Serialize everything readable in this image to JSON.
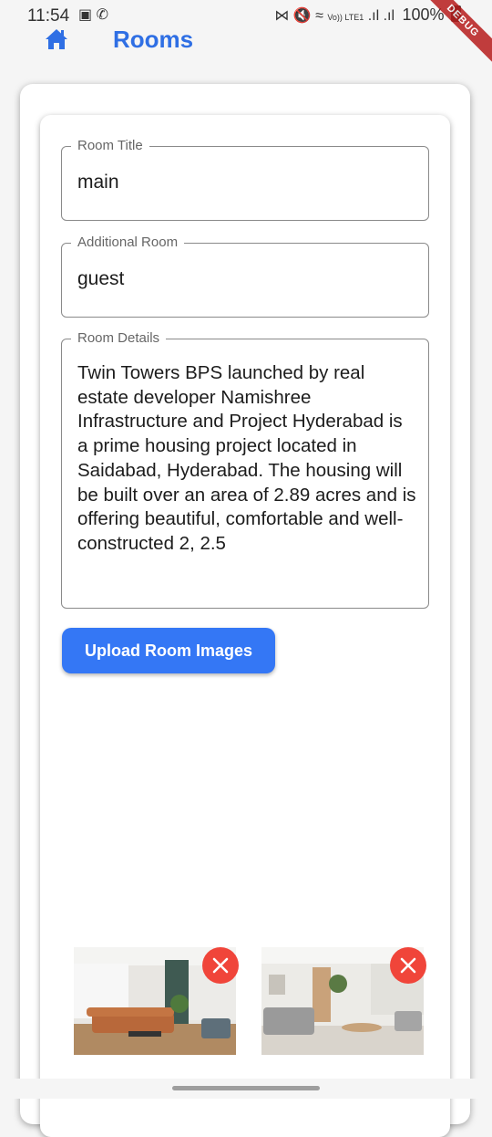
{
  "status_bar": {
    "time": "11:54",
    "battery": "100%",
    "signal_label": "Vo)) LTE1"
  },
  "debug_banner": "DEBUG",
  "header": {
    "title": "Rooms",
    "home_icon": "home-icon"
  },
  "form": {
    "room_title": {
      "label": "Room Title",
      "value": "main"
    },
    "additional_room": {
      "label": "Additional Room",
      "value": "guest"
    },
    "room_details": {
      "label": "Room Details",
      "value": "Twin Towers BPS launched by real estate developer Namishree Infrastructure and Project Hyderabad is a prime housing project located in Saidabad, Hyderabad. The housing will be built over an area of 2.89 acres and is offering beautiful, comfortable and well-constructed 2, 2.5"
    },
    "upload_button": "Upload Room Images"
  },
  "images": [
    {
      "alt": "living room with orange leather sofa",
      "remove_icon": "close-icon"
    },
    {
      "alt": "living room with grey sofa",
      "remove_icon": "close-icon"
    }
  ],
  "colors": {
    "accent": "#3477f5",
    "title": "#2f6fe4",
    "remove": "#f0453a"
  }
}
